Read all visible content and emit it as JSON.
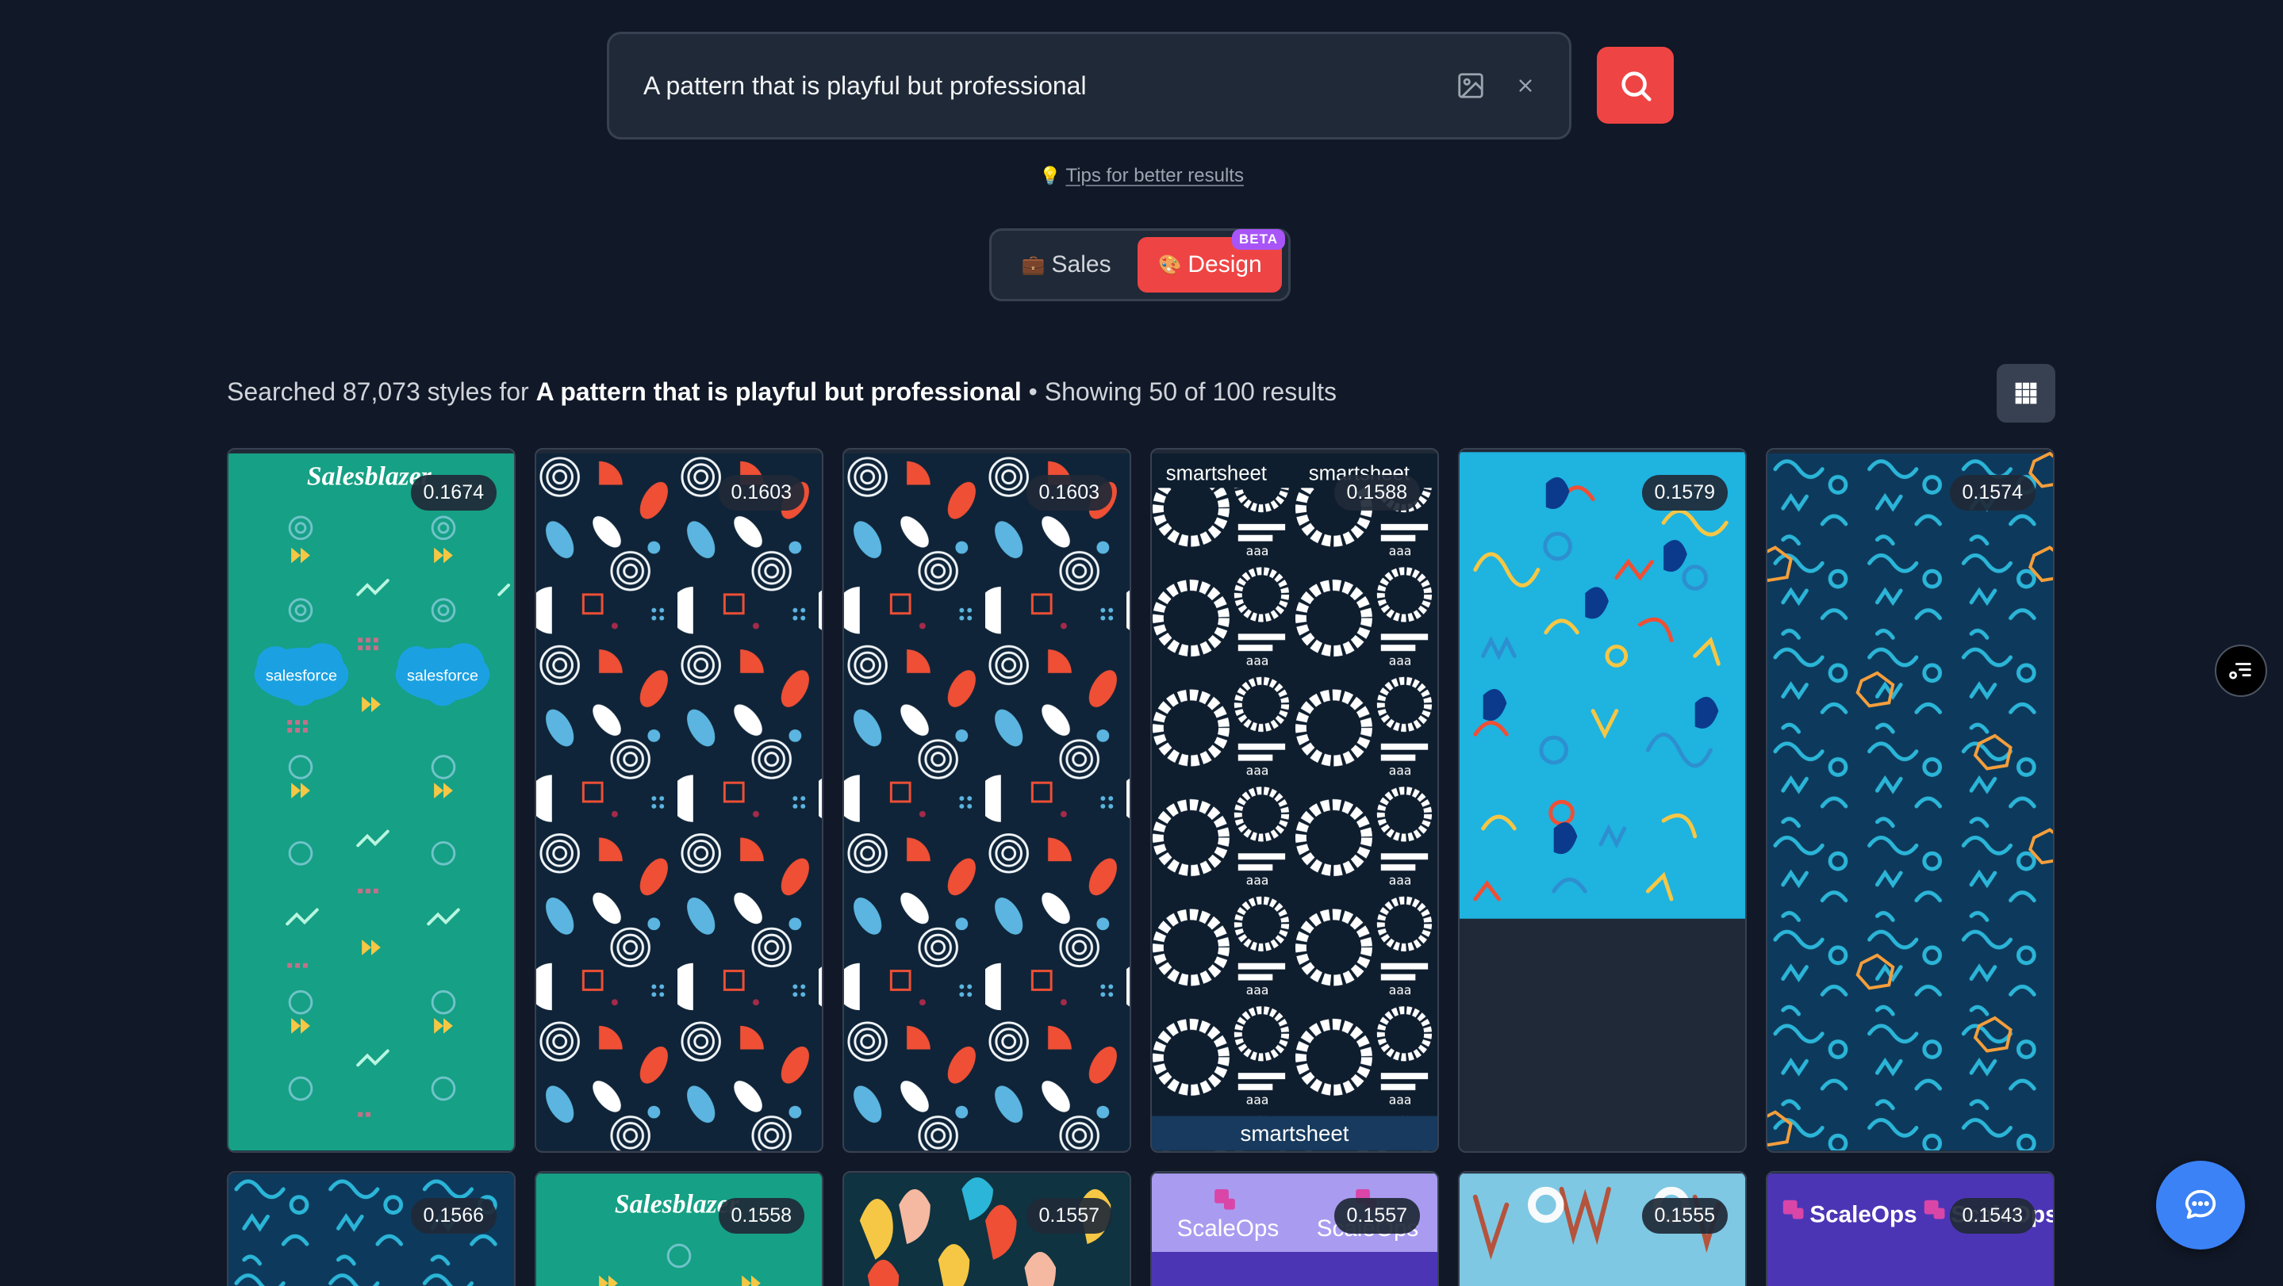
{
  "search": {
    "query": "A pattern that is playful but professional",
    "placeholder": "Describe a style"
  },
  "tips": {
    "label": "Tips for better results"
  },
  "modes": [
    {
      "emoji": "💼",
      "label": "Sales",
      "active": false
    },
    {
      "emoji": "🎨",
      "label": "Design",
      "active": true,
      "badge": "BETA"
    }
  ],
  "results": {
    "prefix": "Searched 87,073 styles for",
    "query": "A pattern that is playful but professional",
    "suffix": "• Showing 50 of 100 results"
  },
  "cards": [
    {
      "score": "0.1674",
      "brand": "Salesblazer",
      "brand2": "salesforce"
    },
    {
      "score": "0.1603"
    },
    {
      "score": "0.1603"
    },
    {
      "score": "0.1588",
      "brand": "smartsheet"
    },
    {
      "score": "0.1579"
    },
    {
      "score": "0.1574"
    },
    {
      "score": "0.1566"
    },
    {
      "score": "0.1558",
      "brand": "Salesblazer"
    },
    {
      "score": "0.1557"
    },
    {
      "score": "0.1557",
      "brand": "ScaleOps"
    },
    {
      "score": "0.1555"
    },
    {
      "score": "0.1543",
      "brand": "ScaleOps"
    }
  ],
  "colors": {
    "background": "#111827",
    "accent": "#ef4444",
    "beta": "#a855f7",
    "chat": "#3b82f6"
  },
  "icons": [
    "image-icon",
    "close-icon",
    "search-icon",
    "lightbulb-icon",
    "grid-icon",
    "filter-icon",
    "chat-icon"
  ]
}
